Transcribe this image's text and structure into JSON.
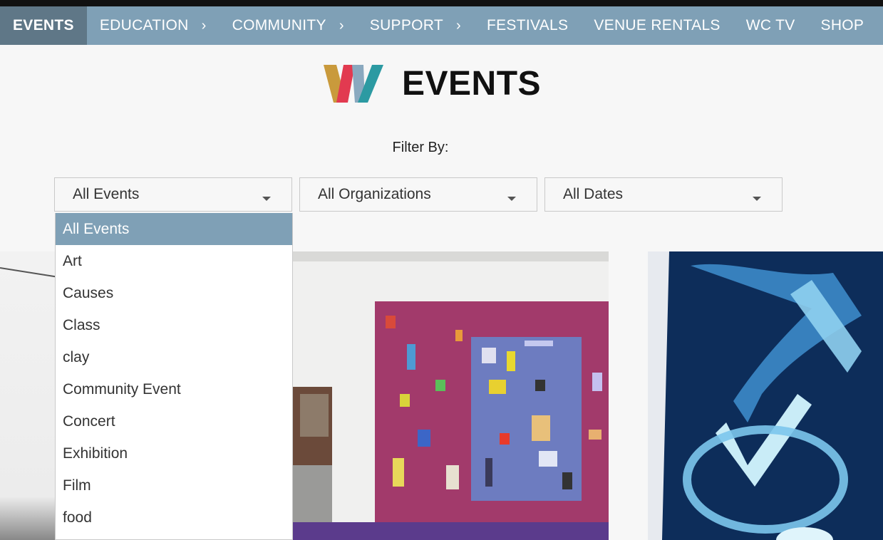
{
  "nav": {
    "items": [
      {
        "label": "EVENTS",
        "active": true,
        "chevron": false
      },
      {
        "label": "EDUCATION",
        "active": false,
        "chevron": true
      },
      {
        "label": "COMMUNITY",
        "active": false,
        "chevron": true
      },
      {
        "label": "SUPPORT",
        "active": false,
        "chevron": true
      },
      {
        "label": "FESTIVALS",
        "active": false,
        "chevron": false
      },
      {
        "label": "VENUE RENTALS",
        "active": false,
        "chevron": false
      },
      {
        "label": "WC TV",
        "active": false,
        "chevron": false
      },
      {
        "label": "SHOP",
        "active": false,
        "chevron": false
      }
    ],
    "chevron_glyph": "›"
  },
  "header": {
    "title": "EVENTS",
    "logo_icon": "wc-logo-icon"
  },
  "filter": {
    "label": "Filter By:",
    "events_value": "All Events",
    "organizations_value": "All Organizations",
    "dates_value": "All Dates"
  },
  "dropdown": {
    "options": [
      "All Events",
      "Art",
      "Causes",
      "Class",
      "clay",
      "Community Event",
      "Concert",
      "Exhibition",
      "Film",
      "food"
    ],
    "selected": "All Events"
  },
  "colors": {
    "nav": "#7fa0b6",
    "nav_active": "#5f7787",
    "accent": "#7fa0b6"
  }
}
